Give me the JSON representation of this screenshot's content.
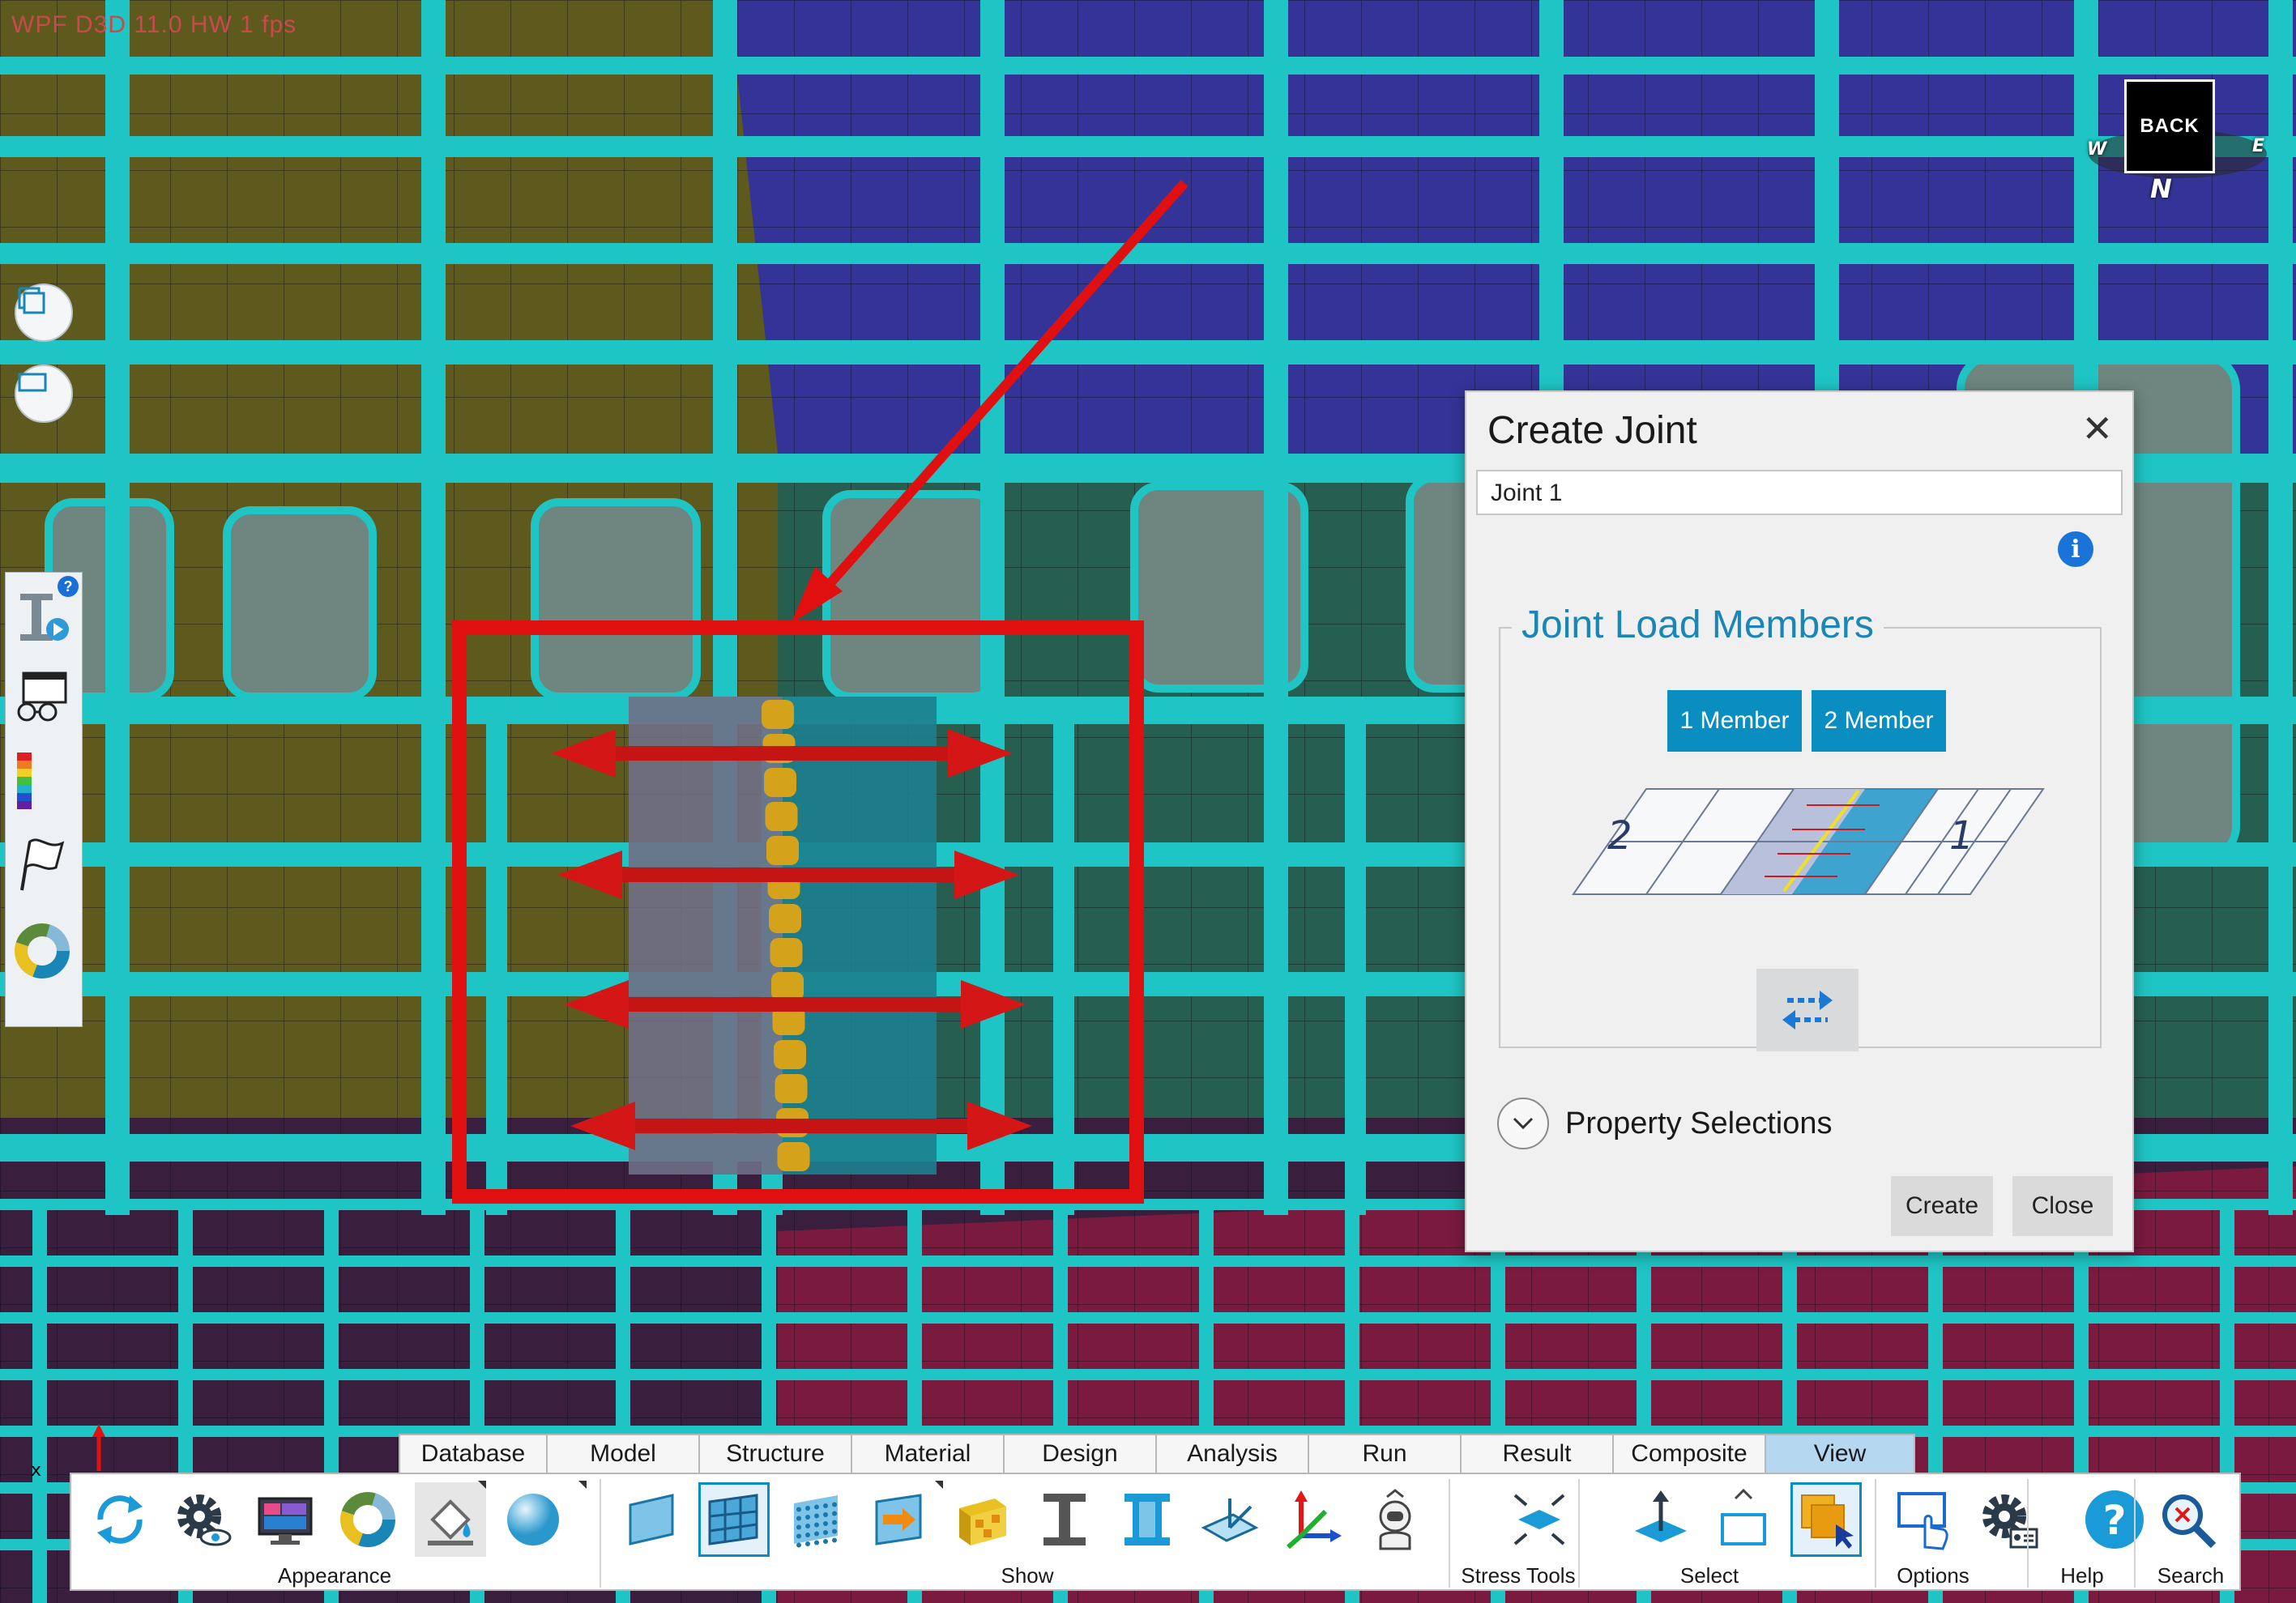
{
  "viewport": {
    "perf_text": "WPF D3D 11.0   HW  1 fps",
    "view_cube_label": "BACK",
    "compass": [
      "N",
      "E",
      "W"
    ]
  },
  "dialog": {
    "title": "Create Joint",
    "close_glyph": "✕",
    "joint_name": "Joint 1",
    "info_glyph": "i",
    "group_title": "Joint Load Members",
    "member_buttons": [
      "1 Member",
      "2 Member"
    ],
    "diagram_labels": [
      "2",
      "1"
    ],
    "property_selections": "Property Selections",
    "create_label": "Create",
    "close_label": "Close"
  },
  "ribbon": {
    "tabs": [
      "Database",
      "Model",
      "Structure",
      "Material",
      "Design",
      "Analysis",
      "Run",
      "Result",
      "Composite",
      "View"
    ],
    "active_tab": "View",
    "groups": {
      "appearance": "Appearance",
      "show": "Show",
      "stress_tools": "Stress Tools",
      "select": "Select",
      "options": "Options",
      "help": "Help",
      "search": "Search"
    }
  },
  "colors": {
    "beam_cyan": "#1fc4c4",
    "olive_panel": "#5e5a1e",
    "blue_panel": "#343498",
    "green_panel": "#265f50",
    "maroon_panel": "#7a1a3e",
    "highlight_red": "#e01010",
    "accent_blue": "#0a8ec2"
  }
}
